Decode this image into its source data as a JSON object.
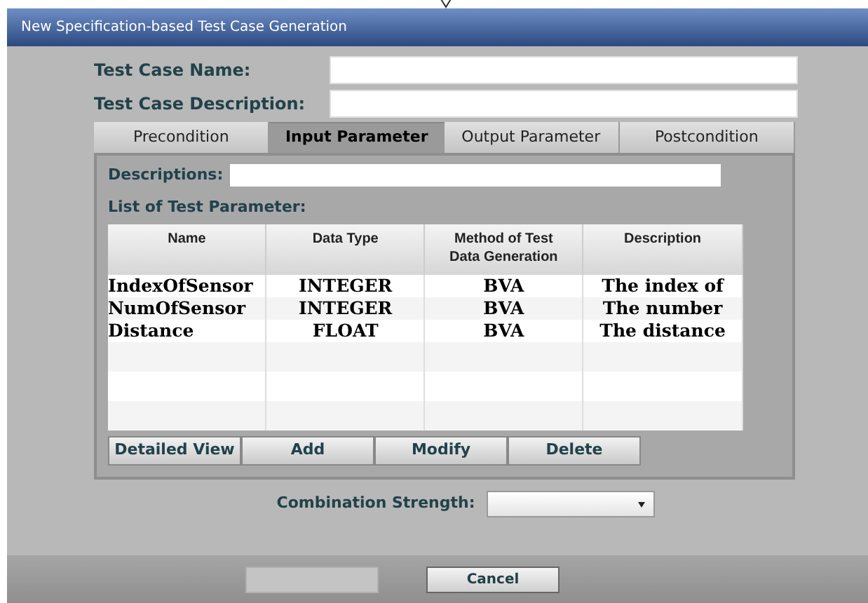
{
  "window": {
    "title": "New Specification-based Test Case Generation"
  },
  "fields": [
    {
      "label": "Test Case Name:"
    },
    {
      "label": "Test Case Description:"
    }
  ],
  "tabs": [
    {
      "label": "Precondition",
      "selected": false
    },
    {
      "label": "Input Parameter",
      "selected": true
    },
    {
      "label": "Output Parameter",
      "selected": false
    },
    {
      "label": "Postcondition",
      "selected": false
    }
  ],
  "descriptions": {
    "label": "Descriptions:"
  },
  "list_label": "List of Test Parameter:",
  "table": {
    "columns": [
      "Name",
      "Data Type",
      "Method of Test Data Generation",
      "Description"
    ],
    "rows": [
      [
        "IndexOfSensor",
        "INTEGER",
        "BVA",
        "The index of"
      ],
      [
        "NumOfSensor",
        "INTEGER",
        "BVA",
        "The number"
      ],
      [
        "Distance",
        "FLOAT",
        "BVA",
        "The distance"
      ]
    ]
  },
  "list_buttons": [
    "Detailed View",
    "Add",
    "Modify",
    "Delete"
  ],
  "combination": {
    "label": "Combination Strength:"
  },
  "footer_buttons": [
    {
      "disabled": true
    },
    {
      "label": "Cancel",
      "disabled": false
    }
  ]
}
